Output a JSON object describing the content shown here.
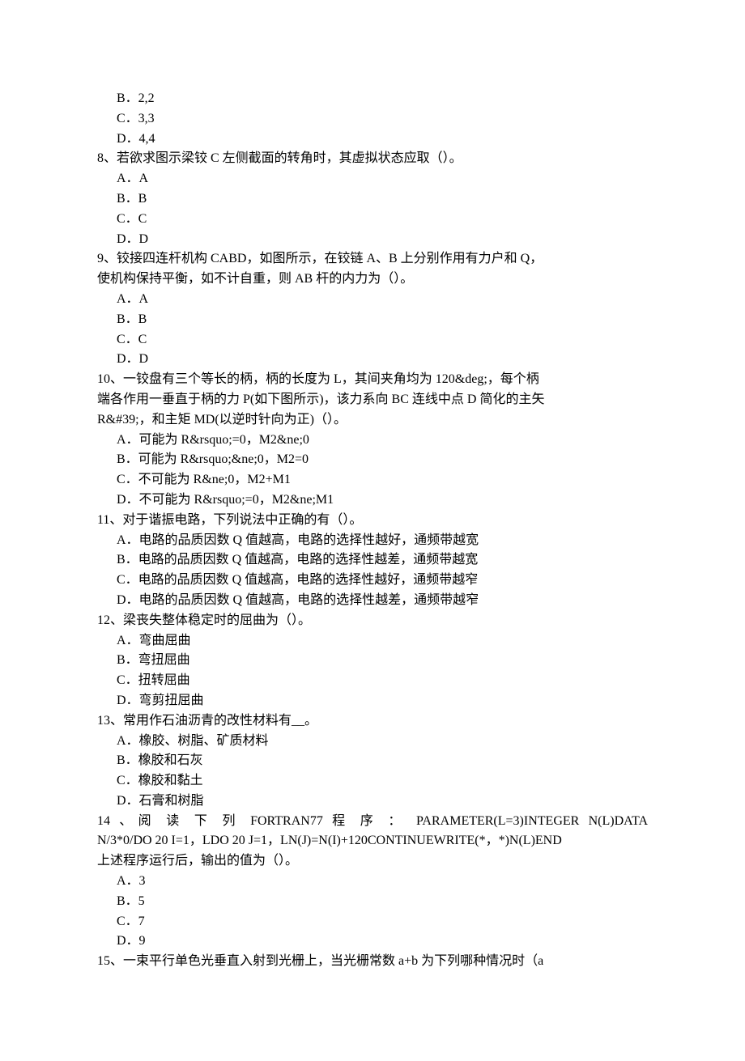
{
  "lines": {
    "o7b": "B．2,2",
    "o7c": "C．3,3",
    "o7d": "D．4,4",
    "q8": "8、若欲求图示梁铰 C 左侧截面的转角时，其虚拟状态应取（）。",
    "o8a": "A．A",
    "o8b": "B．B",
    "o8c": "C．C",
    "o8d": "D．D",
    "q9a": "9、铰接四连杆机构 CABD，如图所示，在铰链 A、B 上分别作用有力户和 Q，",
    "q9b": "使机构保持平衡，如不计自重，则 AB 杆的内力为（）。",
    "o9a": "A．A",
    "o9b": "B．B",
    "o9c": "C．C",
    "o9d": "D．D",
    "q10a": "10、一铰盘有三个等长的柄，柄的长度为 L，其间夹角均为 120&deg;，每个柄",
    "q10b": "端各作用一垂直于柄的力 P(如下图所示)，该力系向 BC 连线中点 D 简化的主矢",
    "q10c": "R&#39;，和主矩 MD(以逆时针向为正)（）。",
    "o10a": "A．可能为 R&rsquo;=0，M2&ne;0",
    "o10b": "B．可能为 R&rsquo;&ne;0，M2=0",
    "o10c": "C．不可能为 R&ne;0，M2+M1",
    "o10d": "D．不可能为 R&rsquo;=0，M2&ne;M1",
    "q11": "11、对于谐振电路，下列说法中正确的有（）。",
    "o11a": "A．电路的品质因数 Q 值越高，电路的选择性越好，通频带越宽",
    "o11b": "B．电路的品质因数 Q 值越高，电路的选择性越差，通频带越宽",
    "o11c": "C．电路的品质因数 Q 值越高，电路的选择性越好，通频带越窄",
    "o11d": "D．电路的品质因数 Q 值越高，电路的选择性越差，通频带越窄",
    "q12": "12、梁丧失整体稳定时的屈曲为（）。",
    "o12a": "A．弯曲屈曲",
    "o12b": "B．弯扭屈曲",
    "o12c": "C．扭转屈曲",
    "o12d": "D．弯剪扭屈曲",
    "q13": "13、常用作石油沥青的改性材料有__。",
    "o13a": "A．橡胶、树脂、矿质材料",
    "o13b": "B．橡胶和石灰",
    "o13c": "C．橡胶和黏土",
    "o13d": "D．石膏和树脂",
    "q14a": "14 、阅 读 下 列 FORTRAN77 程 序 ： PARAMETER(L=3)INTEGER N(L)DATA",
    "q14b": "N/3*0/DO 20 I=1，LDO 20 J=1，LN(J)=N(I)+120CONTINUEWRITE(*，*)N(L)END",
    "q14c": "上述程序运行后，输出的值为（）。",
    "o14a": "A．3",
    "o14b": "B．5",
    "o14c": "C．7",
    "o14d": "D．9",
    "q15": "15、一束平行单色光垂直入射到光栅上，当光栅常数 a+b 为下列哪种情况时（a"
  }
}
